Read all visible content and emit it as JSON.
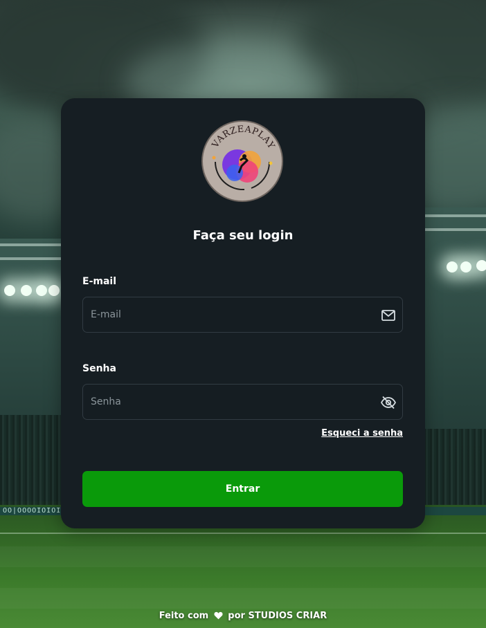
{
  "background": {
    "ad_board_text": "OO|OOOOIOIOIO"
  },
  "logo": {
    "text": "VARZEAPLAY"
  },
  "login": {
    "title": "Faça seu login",
    "email_label": "E-mail",
    "email_placeholder": "E-mail",
    "email_value": "",
    "password_label": "Senha",
    "password_placeholder": "Senha",
    "password_value": "",
    "forgot_password": "Esqueci a senha",
    "submit_label": "Entrar"
  },
  "footer": {
    "prefix": "Feito com",
    "suffix": "por STUDIOS CRIAR"
  },
  "icons": {
    "email": "mail-icon",
    "password_toggle": "eye-off-icon",
    "footer": "heart-icon"
  },
  "colors": {
    "card_background": "#161e23",
    "button_green": "#0a9a0a",
    "input_border": "#323c43",
    "text_white": "#ffffff"
  }
}
